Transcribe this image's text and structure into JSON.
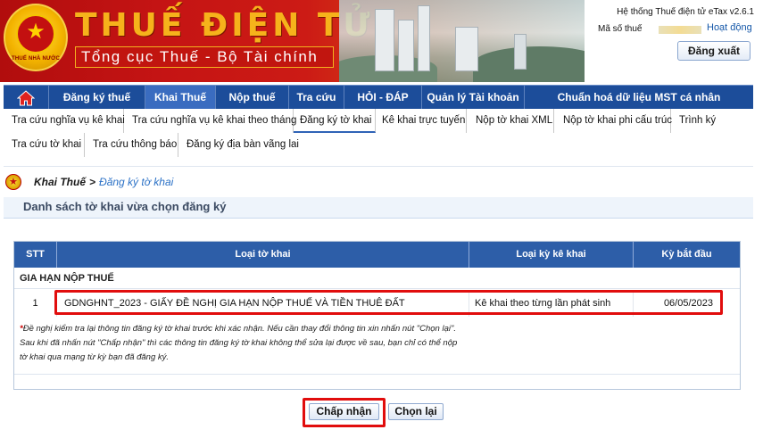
{
  "header": {
    "title_main": "THUẾ ĐIỆN TỬ",
    "title_sub": "Tổng cục Thuế - Bộ Tài chính",
    "emblem_text": "THUẾ NHÀ NƯỚC",
    "system_name": "Hệ thống Thuế điện tử eTax v2.6.1",
    "tax_code_label": "Mã số thuế",
    "account_link": "Hoạt động",
    "logout_label": "Đăng xuất"
  },
  "main_nav": {
    "items": [
      {
        "label": "Đăng ký thuế"
      },
      {
        "label": "Khai Thuế"
      },
      {
        "label": "Nộp thuế"
      },
      {
        "label": "Tra cứu"
      },
      {
        "label": "HỎI - ĐÁP"
      },
      {
        "label": "Quản lý Tài khoản"
      },
      {
        "label": "Chuẩn hoá dữ liệu MST cá nhân"
      }
    ]
  },
  "sub_nav": {
    "items": [
      {
        "label": "Tra cứu nghĩa vụ kê khai"
      },
      {
        "label": "Tra cứu nghĩa vụ kê khai theo tháng"
      },
      {
        "label": "Đăng ký tờ khai"
      },
      {
        "label": "Kê khai trực tuyến"
      },
      {
        "label": "Nộp tờ khai XML"
      },
      {
        "label": "Nộp tờ khai phi cấu trúc"
      },
      {
        "label": "Trình ký"
      },
      {
        "label": "Tra cứu tờ khai"
      },
      {
        "label": "Tra cứu thông báo"
      },
      {
        "label": "Đăng ký địa bàn vãng lai"
      }
    ]
  },
  "breadcrumb": {
    "first": "Khai Thuế",
    "separator": ">",
    "current": "Đăng ký tờ khai"
  },
  "section_title": "Danh sách tờ khai vừa chọn đăng ký",
  "table": {
    "headers": [
      "STT",
      "Loại tờ khai",
      "Loại kỳ kê khai",
      "Kỳ bắt đầu"
    ],
    "group_label": "GIA HẠN NỘP THUẾ",
    "rows": [
      {
        "stt": "1",
        "form": "GDNGHNT_2023 - GIẤY ĐỀ NGHỊ GIA HẠN NỘP THUẾ VÀ TIỀN THUÊ ĐẤT",
        "period_type": "Kê khai theo từng lần phát sinh",
        "start": "06/05/2023"
      }
    ]
  },
  "note": {
    "star": "*",
    "line1": "Đề nghị kiểm tra lại thông tin đăng ký tờ khai trước khi xác nhận. Nếu cần thay đổi thông tin xin nhấn nút \"Chọn lại\".",
    "line2": "Sau khi đã nhấn nút \"Chấp nhận\" thì các thông tin đăng ký tờ khai không thể sửa lại được về sau, bạn chỉ có thể nộp",
    "line3": "tờ khai qua mạng từ kỳ bạn đã đăng ký."
  },
  "buttons": {
    "accept": "Chấp nhận",
    "reselect": "Chọn lại"
  },
  "colors": {
    "nav_bg": "#1c4d9a",
    "table_header_bg": "#2d5ea8",
    "highlight": "#e10d0d",
    "link": "#2b71c6"
  }
}
